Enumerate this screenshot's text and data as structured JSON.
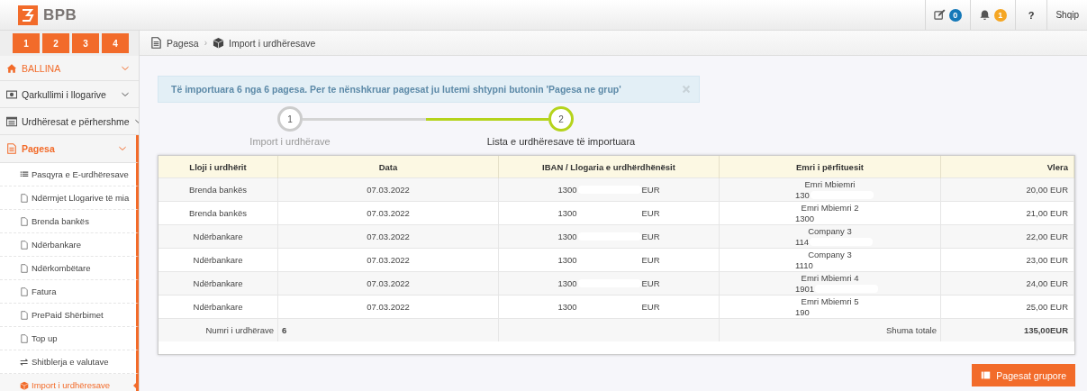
{
  "header": {
    "logo": "BPB",
    "counters": [
      {
        "kind": "edit",
        "count": "0",
        "color": "#1478b8"
      },
      {
        "kind": "bell",
        "count": "1",
        "color": "#f5a623"
      }
    ],
    "help": "?",
    "language": "Shqip"
  },
  "quick_buttons": [
    "1",
    "2",
    "3",
    "4"
  ],
  "sidebar": {
    "items": [
      {
        "label": "BALLINA",
        "accent": true,
        "selected": false
      },
      {
        "label": "Qarkullimi i llogarive",
        "accent": false,
        "selected": false
      },
      {
        "label": "Urdhëresat e përhershme",
        "accent": false,
        "selected": false
      },
      {
        "label": "Pagesa",
        "accent": true,
        "selected": true,
        "children": [
          {
            "label": "Pasqyra e E-urdhëresave",
            "selected": false
          },
          {
            "label": "Ndërmjet Llogarive të mia",
            "selected": false
          },
          {
            "label": "Brenda bankës",
            "selected": false
          },
          {
            "label": "Ndërbankare",
            "selected": false
          },
          {
            "label": "Ndërkombëtare",
            "selected": false
          },
          {
            "label": "Fatura",
            "selected": false
          },
          {
            "label": "PrePaid Shërbimet",
            "selected": false
          },
          {
            "label": "Top up",
            "selected": false
          },
          {
            "label": "Shitblerja e valutave",
            "selected": false
          },
          {
            "label": "Import i urdhëresave",
            "selected": true
          }
        ]
      }
    ]
  },
  "breadcrumb": {
    "separator": "›",
    "items": [
      {
        "label": "Pagesa"
      },
      {
        "label": "Import i urdhëresave"
      }
    ]
  },
  "alert": {
    "message": "Të importuara 6 nga 6 pagesa. Per te nënshkruar pagesat ju lutemi shtypni butonin 'Pagesa ne grup'"
  },
  "steps": [
    {
      "number": "1",
      "label": "Import i urdhërave",
      "selected": false
    },
    {
      "number": "2",
      "label": "Lista e urdhëresave të importuara",
      "selected": true
    }
  ],
  "table": {
    "columns": [
      "Lloji i urdhërit",
      "Data",
      "IBAN / Llogaria e urdhërdhënësit",
      "Emri i përfituesit",
      "Vlera"
    ],
    "rows": [
      {
        "type": "Brenda bankës",
        "date": "07.03.2022",
        "iban_start": "1300",
        "iban_end": "EUR",
        "beneficiary": "Emri Mbiemri",
        "beneficiary_account": "130",
        "amount": "20,00 EUR"
      },
      {
        "type": "Brenda bankës",
        "date": "07.03.2022",
        "iban_start": "1300",
        "iban_end": "EUR",
        "beneficiary": "Emri Mbiemri 2",
        "beneficiary_account": "1300",
        "amount": "21,00 EUR"
      },
      {
        "type": "Ndërbankare",
        "date": "07.03.2022",
        "iban_start": "1300",
        "iban_end": "EUR",
        "beneficiary": "Company 3",
        "beneficiary_account": "114",
        "amount": "22,00 EUR"
      },
      {
        "type": "Ndërbankare",
        "date": "07.03.2022",
        "iban_start": "1300",
        "iban_end": "EUR",
        "beneficiary": "Company 3",
        "beneficiary_account": "1110",
        "amount": "23,00 EUR"
      },
      {
        "type": "Ndërbankare",
        "date": "07.03.2022",
        "iban_start": "1300",
        "iban_end": "EUR",
        "beneficiary": "Emri Mbiemri 4",
        "beneficiary_account": "1901",
        "amount": "24,00 EUR"
      },
      {
        "type": "Ndërbankare",
        "date": "07.03.2022",
        "iban_start": "1300",
        "iban_end": "EUR",
        "beneficiary": "Emri Mbiemri 5",
        "beneficiary_account": "190",
        "amount": "25,00 EUR"
      }
    ],
    "footer": {
      "count_label": "Numri i urdhërave",
      "count": "6",
      "total_label": "Shuma totale",
      "total": "135,00EUR"
    }
  },
  "action_button": "Pagesat grupore"
}
